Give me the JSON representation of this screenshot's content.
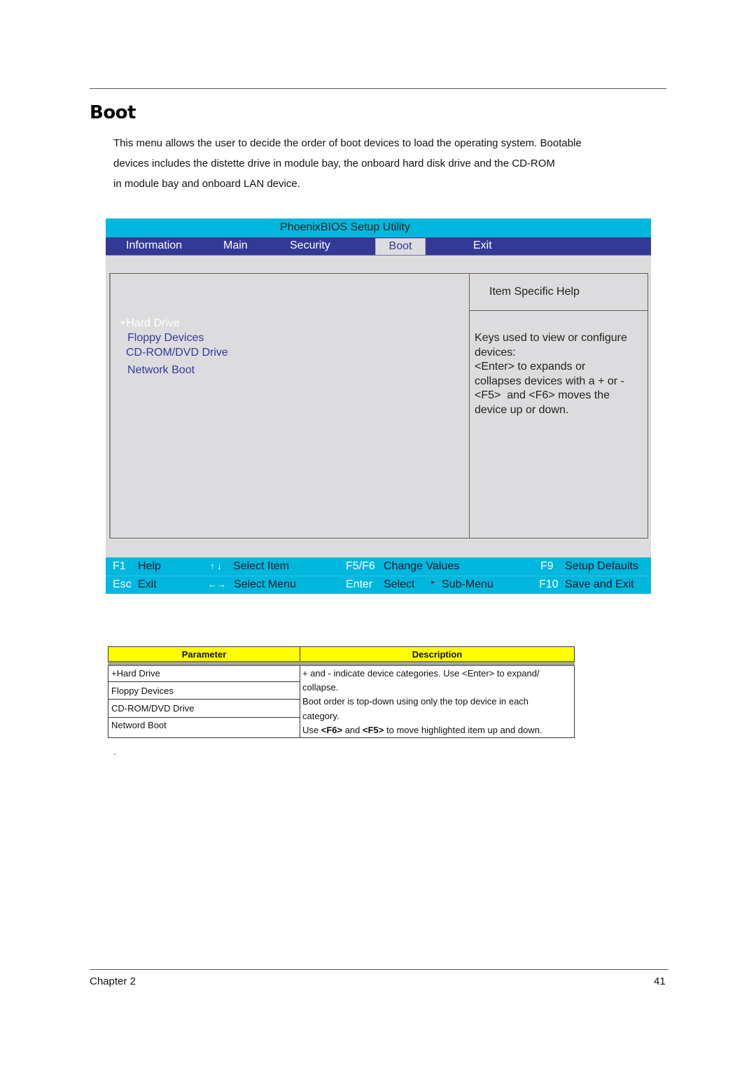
{
  "document": {
    "title": "Boot",
    "intro_lines": [
      "This menu allows the user to decide the order of boot devices to load the operating system. Bootable",
      "devices includes the distette drive in module bay, the onboard hard disk drive and the CD-ROM",
      "in module bay and onboard LAN device."
    ]
  },
  "bios": {
    "title": "PhoenixBIOS Setup Utility",
    "menu_tabs": [
      {
        "label": "Information",
        "active": false
      },
      {
        "label": "Main",
        "active": false
      },
      {
        "label": "Security",
        "active": false
      },
      {
        "label": "Boot",
        "active": true
      },
      {
        "label": "Exit",
        "active": false
      }
    ],
    "boot_items": [
      {
        "label": "+Hard Drive",
        "selected": true
      },
      {
        "label": "Floppy Devices",
        "selected": false
      },
      {
        "label": "CD-ROM/DVD Drive",
        "selected": false
      },
      {
        "label": "Network Boot",
        "selected": false
      }
    ],
    "help": {
      "title": "Item Specific Help",
      "lines": [
        "Keys used to view or configure",
        "devices:",
        "<Enter> to expands or",
        "collapses devices with a + or -",
        "<F5>  and <F6> moves the",
        "device up or down."
      ]
    },
    "footer": {
      "row1": [
        {
          "key": "F1",
          "desc": "Help"
        },
        {
          "key": "↑ ↓",
          "desc": "Select Item"
        },
        {
          "key": "F5/F6",
          "desc": "Change Values"
        },
        {
          "key": "F9",
          "desc": "Setup Defaults"
        }
      ],
      "row2": [
        {
          "key": "Esc",
          "desc": "Exit"
        },
        {
          "key": "←→",
          "desc": "Select Menu"
        },
        {
          "key": "Enter",
          "desc": "Select"
        },
        {
          "key": "▸",
          "desc": "Sub-Menu"
        },
        {
          "key": "F10",
          "desc": "Save and Exit"
        }
      ]
    },
    "colors": {
      "title_bar": "#00b7de",
      "menu_bar": "#323a96",
      "panel_bg": "#dcdcde",
      "item_text": "#333a9a"
    }
  },
  "param_table": {
    "headers": [
      "Parameter",
      "Description"
    ],
    "parameters": [
      "+Hard Drive",
      "Floppy Devices",
      "CD-ROM/DVD Drive",
      "Netword Boot"
    ],
    "description_lines": [
      "+ and - indicate device categories. Use <Enter> to expand/",
      "collapse.",
      "Boot order is top-down using only the top device in each",
      "category."
    ],
    "description_last": {
      "prefix": "Use ",
      "key1": "<F6>",
      "middle": " and ",
      "key2": "<F5>",
      "suffix": " to move highlighted item up and down."
    },
    "header_color": "#ffff00"
  },
  "trailing_dot": ".",
  "page_footer": {
    "chapter": "Chapter 2",
    "page_number": "41"
  }
}
